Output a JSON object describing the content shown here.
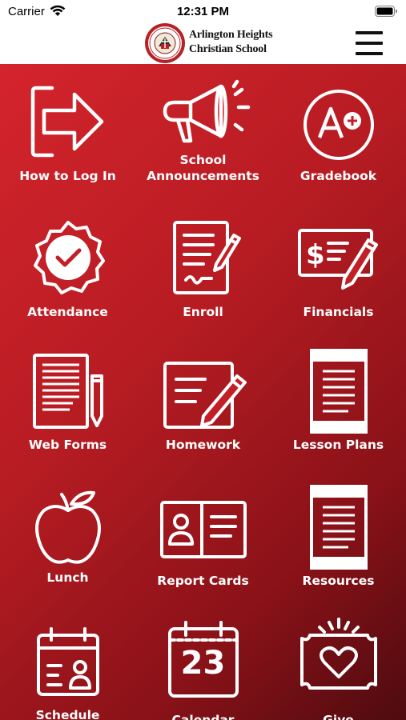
{
  "status_bar": {
    "carrier": "Carrier",
    "time": "12:31 PM"
  },
  "header": {
    "school_name_line1": "Arlington Heights",
    "school_name_line2": "Christian School",
    "logo_icon": "school-crest-icon",
    "menu_icon": "hamburger-menu-icon"
  },
  "colors": {
    "accent": "#c8202a",
    "accent_dark": "#4e0b10",
    "tile_icon": "#ffffff"
  },
  "tiles": [
    {
      "label": "How to Log In",
      "icon": "login-arrow-icon"
    },
    {
      "label": "School\nAnnouncements",
      "label_line1": "School",
      "label_line2": "Announcements",
      "icon": "megaphone-icon"
    },
    {
      "label": "Gradebook",
      "icon": "a-plus-grade-icon"
    },
    {
      "label": "Attendance",
      "icon": "checkmark-badge-icon"
    },
    {
      "label": "Enroll",
      "icon": "document-sign-icon"
    },
    {
      "label": "Financials",
      "icon": "check-payment-icon"
    },
    {
      "label": "Web Forms",
      "icon": "form-pencil-icon"
    },
    {
      "label": "Homework",
      "icon": "notebook-pencil-icon"
    },
    {
      "label": "Lesson Plans",
      "icon": "tablet-document-icon"
    },
    {
      "label": "Lunch",
      "icon": "apple-icon"
    },
    {
      "label": "Report Cards",
      "icon": "id-card-book-icon"
    },
    {
      "label": "Resources",
      "icon": "tablet-document-icon"
    },
    {
      "label": "Schedule",
      "icon": "calendar-person-icon"
    },
    {
      "label": "Calendar",
      "icon": "calendar-23-icon",
      "calendar_day": "23"
    },
    {
      "label": "Give",
      "icon": "heart-banknote-icon"
    }
  ]
}
